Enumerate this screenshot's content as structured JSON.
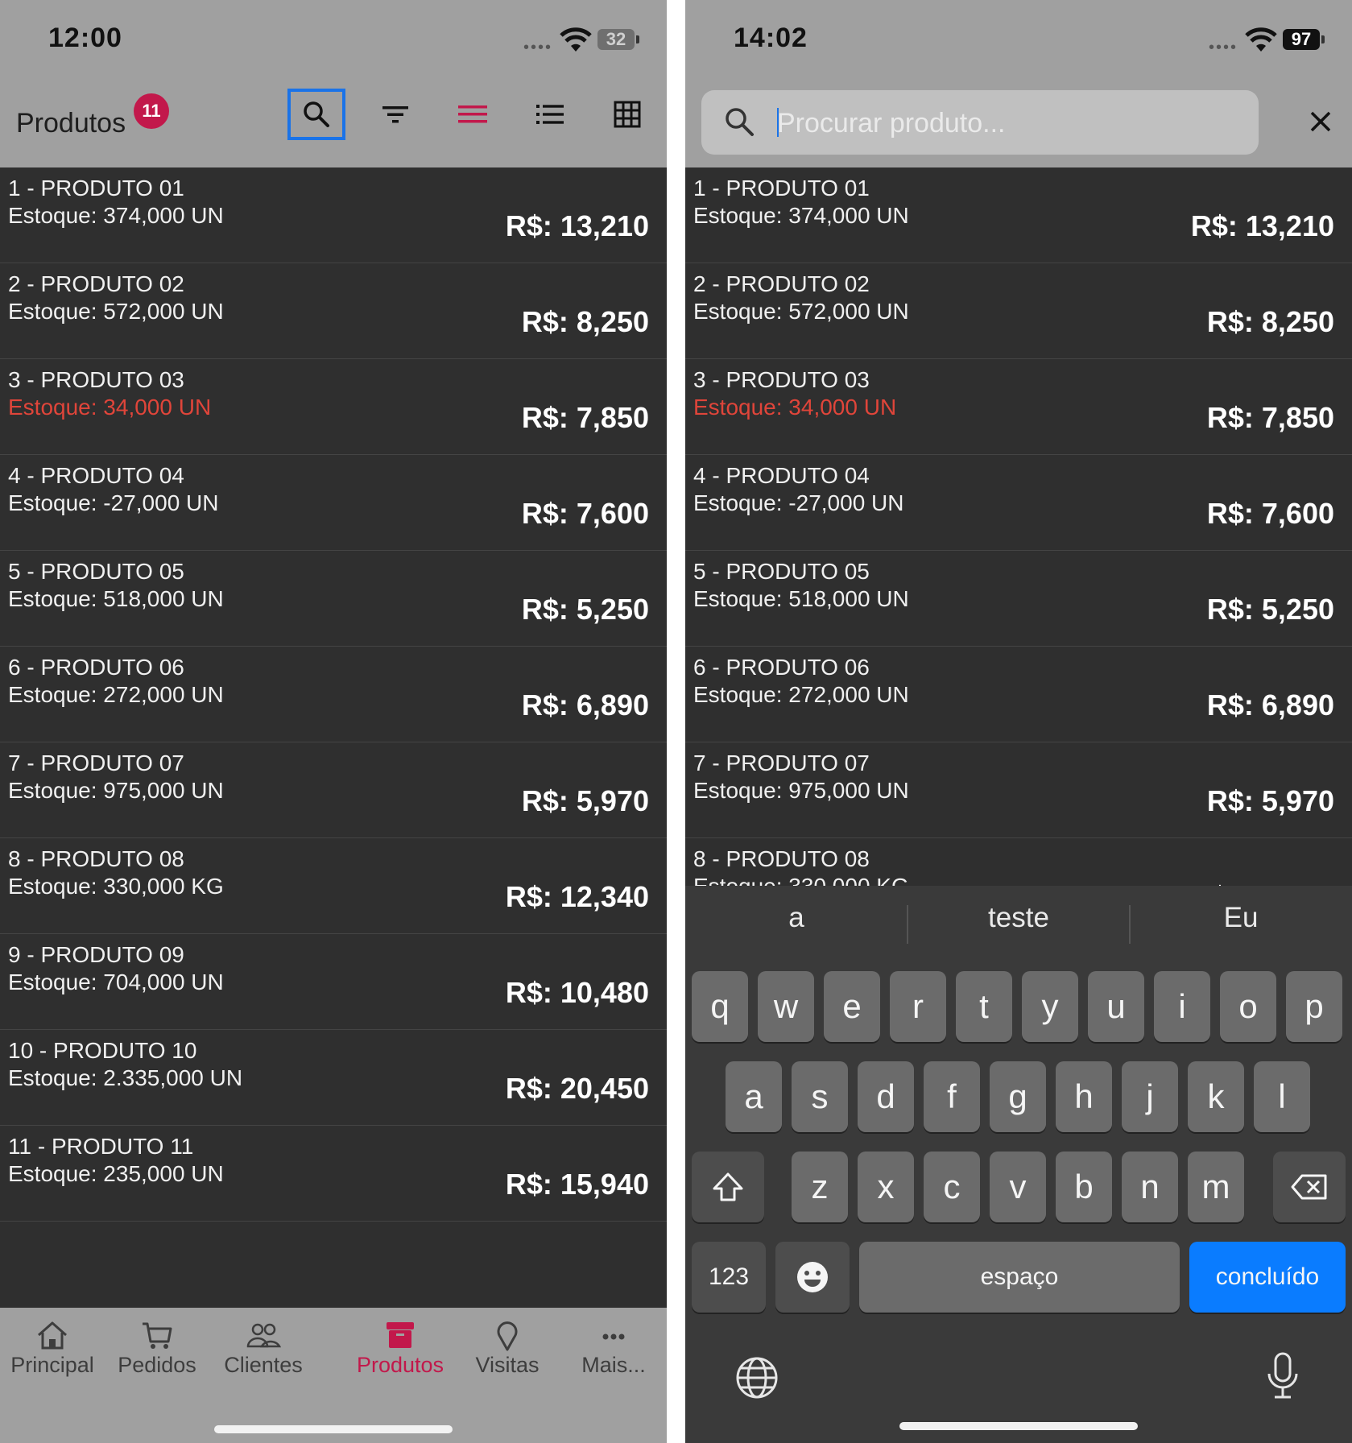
{
  "left": {
    "status": {
      "time": "12:00",
      "battery": "32"
    },
    "header": {
      "title": "Produtos",
      "badge": "11"
    },
    "toolbar": {
      "icons": [
        "search-icon",
        "filter-icon",
        "menu-lines-icon",
        "list-view-icon",
        "grid-view-icon"
      ],
      "active_icon_color": "#c2184b",
      "focus_color": "#1a73e8"
    },
    "products": [
      {
        "name": "1 - PRODUTO 01",
        "stock": "Estoque: 374,000 UN",
        "price": "R$: 13,210"
      },
      {
        "name": "2 - PRODUTO 02",
        "stock": "Estoque: 572,000 UN",
        "price": "R$: 8,250"
      },
      {
        "name": "3 - PRODUTO 03",
        "stock": "Estoque: 34,000 UN",
        "price": "R$: 7,850"
      },
      {
        "name": "4 - PRODUTO 04",
        "stock": "Estoque: -27,000 UN",
        "price": "R$: 7,600"
      },
      {
        "name": "5 - PRODUTO 05",
        "stock": "Estoque: 518,000 UN",
        "price": "R$: 5,250"
      },
      {
        "name": "6 - PRODUTO 06",
        "stock": "Estoque: 272,000 UN",
        "price": "R$: 6,890"
      },
      {
        "name": "7 - PRODUTO 07",
        "stock": "Estoque: 975,000 UN",
        "price": "R$: 5,970"
      },
      {
        "name": "8 - PRODUTO 08",
        "stock": "Estoque: 330,000 KG",
        "price": "R$: 12,340"
      },
      {
        "name": "9 - PRODUTO 09",
        "stock": "Estoque: 704,000 UN",
        "price": "R$: 10,480"
      },
      {
        "name": "10 - PRODUTO 10",
        "stock": "Estoque: 2.335,000 UN",
        "price": "R$: 20,450"
      },
      {
        "name": "11 - PRODUTO 11",
        "stock": "Estoque: 235,000 UN",
        "price": "R$: 15,940"
      }
    ],
    "nav": [
      {
        "label": "Principal",
        "icon": "home-icon"
      },
      {
        "label": "Pedidos",
        "icon": "cart-icon"
      },
      {
        "label": "Clientes",
        "icon": "users-icon"
      },
      {
        "label": "Produtos",
        "icon": "box-icon"
      },
      {
        "label": "Visitas",
        "icon": "pin-icon"
      },
      {
        "label": "Mais...",
        "icon": "more-icon"
      }
    ],
    "low_stock_color": "#e0453a"
  },
  "right": {
    "status": {
      "time": "14:02",
      "battery": "97"
    },
    "search": {
      "placeholder": "Procurar produto...",
      "value": ""
    },
    "suggestions": [
      "a",
      "teste",
      "Eu"
    ],
    "keyboard": {
      "row1": [
        "q",
        "w",
        "e",
        "r",
        "t",
        "y",
        "u",
        "i",
        "o",
        "p"
      ],
      "row2": [
        "a",
        "s",
        "d",
        "f",
        "g",
        "h",
        "j",
        "k",
        "l"
      ],
      "row3": [
        "z",
        "x",
        "c",
        "v",
        "b",
        "n",
        "m"
      ],
      "numbers_label": "123",
      "space_label": "espaço",
      "done_label": "concluído"
    }
  }
}
